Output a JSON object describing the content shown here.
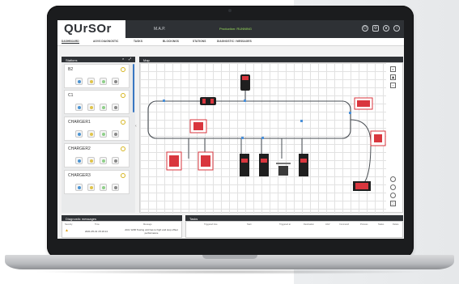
{
  "app": {
    "logo": "QUrSOr",
    "map_title": "M.A.P.",
    "production_status": "Production: RUNNING",
    "icons": [
      "power-icon",
      "gear-icon",
      "user-icon",
      "info-icon"
    ]
  },
  "tabs": [
    {
      "label": "DASHBOARD",
      "active": true
    },
    {
      "label": "AGVS DIAGNOSTIC",
      "active": false
    },
    {
      "label": "TASKS",
      "active": false
    },
    {
      "label": "BLOCKINGS",
      "active": false
    },
    {
      "label": "STATIONS",
      "active": false
    },
    {
      "label": "DIAGNOSTIC / MESSAGES",
      "active": false
    }
  ],
  "stations_panel": {
    "title": "Stations",
    "items": [
      {
        "name": "B2"
      },
      {
        "name": "C1"
      },
      {
        "name": "CHARGER1"
      },
      {
        "name": "CHARGER2"
      },
      {
        "name": "CHARGER3"
      }
    ]
  },
  "map_panel": {
    "title": "Map"
  },
  "diagnostic_panel": {
    "title": "Diagnostic messages",
    "columns": [
      "Severity",
      "Time",
      "Message"
    ],
    "rows": [
      {
        "time": "2021-05-31 15:19:14",
        "message": "AGV 1206 Towing unit has to high and stop offset performance"
      }
    ]
  },
  "tasks_panel": {
    "title": "Tasks",
    "columns": [
      "Triggered time",
      "Start",
      "Triggered at",
      "Destination",
      "AGV",
      "Command",
      "Process",
      "Status",
      "Delete"
    ]
  },
  "colors": {
    "topbar": "#2e3135",
    "accent_green": "#9be15d",
    "agv_red": "#d9363e",
    "track": "#4a4f55"
  }
}
